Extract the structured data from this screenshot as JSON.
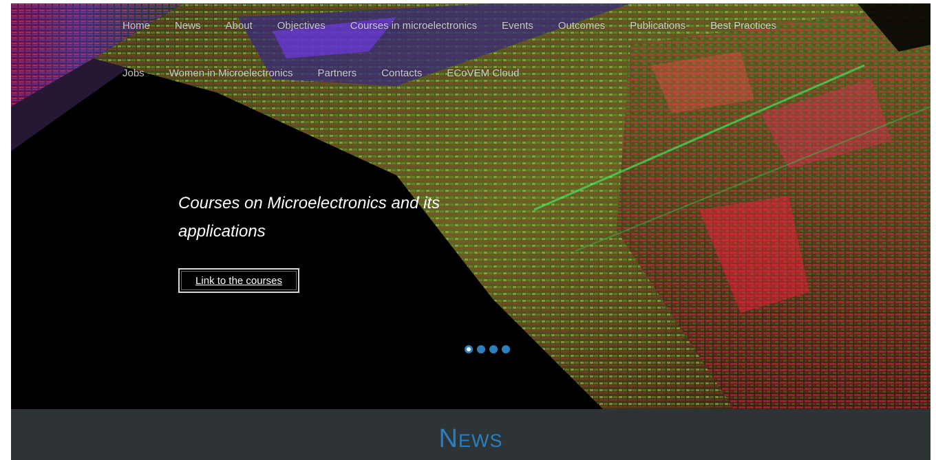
{
  "nav": {
    "row1": [
      "Home",
      "News",
      "About",
      "Objectives",
      "Courses in microelectronics",
      "Events",
      "Outcomes",
      "Publications",
      "Best Practices"
    ],
    "row2": [
      "Jobs",
      "Women in Microelectronics",
      "Partners",
      "Contacts",
      "ECoVEM Cloud"
    ]
  },
  "hero": {
    "caption": "Courses on Microelectronics and its applications",
    "button_label": "Link to the courses",
    "slides_count": 4,
    "active_slide": 1,
    "background": "microchip-die-photo"
  },
  "news": {
    "heading": "News"
  },
  "colors": {
    "accent": "#2a7fc1",
    "news_bg": "#2e3336",
    "hero_bg": "#000000"
  }
}
